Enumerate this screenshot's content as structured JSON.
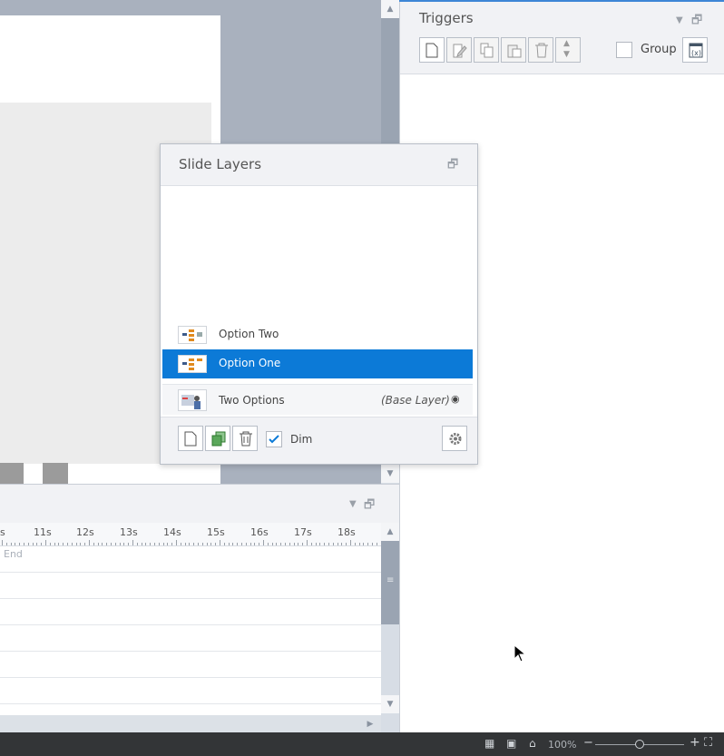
{
  "triggers": {
    "title": "Triggers",
    "group_label": "Group",
    "group_checked": false,
    "toolbar": [
      "new-trigger",
      "edit-trigger",
      "copy-trigger",
      "paste-trigger",
      "delete-trigger",
      "reorder-trigger"
    ]
  },
  "slide_layers": {
    "title": "Slide Layers",
    "layers": [
      {
        "name": "Option Two",
        "selected": false,
        "suffix": ""
      },
      {
        "name": "Option One",
        "selected": true,
        "suffix": ""
      },
      {
        "name": "Two Options",
        "selected": false,
        "suffix": "(Base Layer)"
      }
    ],
    "dim_label": "Dim",
    "dim_checked": true
  },
  "timeline": {
    "ticks": [
      "s",
      "11s",
      "12s",
      "13s",
      "14s",
      "15s",
      "16s",
      "17s",
      "18s"
    ],
    "end_label": "End"
  },
  "statusbar": {
    "zoom": "100%",
    "zoom_minus": "−",
    "zoom_plus": "+"
  },
  "colors": {
    "accent": "#0c7ad7",
    "statusbar": "#333537"
  }
}
